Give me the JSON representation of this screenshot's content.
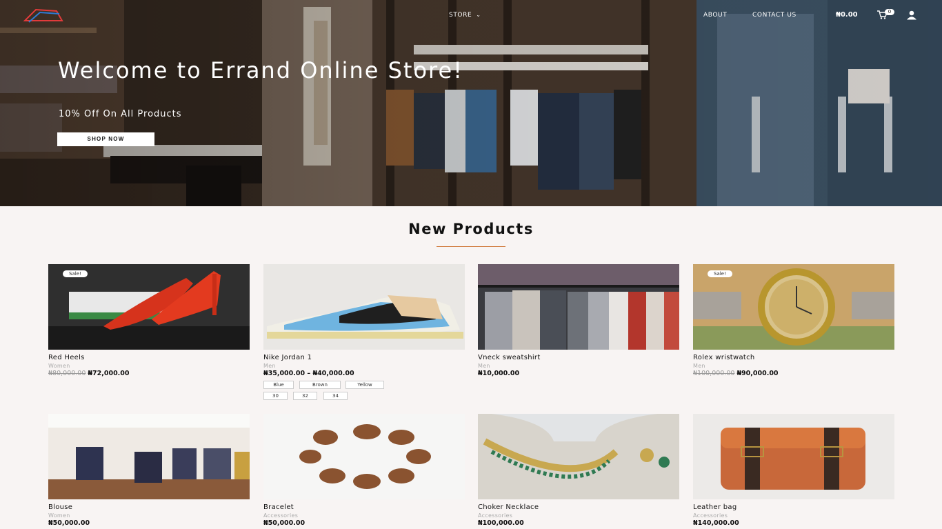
{
  "header": {
    "nav": {
      "store": "STORE",
      "about": "ABOUT",
      "contact": "CONTACT US"
    },
    "cart_total": "₦0.00",
    "cart_count": "0"
  },
  "hero": {
    "title": "Welcome to Errand Online Store!",
    "subtitle": "10% Off On All Products",
    "button": "SHOP NOW"
  },
  "section": {
    "title": "New Products"
  },
  "products": [
    {
      "name": "Red Heels",
      "category": "Women",
      "old_price": "₦80,000.00",
      "price": "₦72,000.00",
      "badge": "Sale!"
    },
    {
      "name": "Nike Jordan 1",
      "category": "Men",
      "price": "₦35,000.00 – ₦40,000.00",
      "colors": [
        "Blue",
        "Brown",
        "Yellow"
      ],
      "sizes": [
        "30",
        "32",
        "34"
      ]
    },
    {
      "name": "Vneck sweatshirt",
      "category": "Men",
      "price": "₦10,000.00"
    },
    {
      "name": "Rolex wristwatch",
      "category": "Men",
      "old_price": "₦100,000.00",
      "price": "₦90,000.00",
      "badge": "Sale!"
    },
    {
      "name": "Blouse",
      "category": "Women",
      "price": "₦50,000.00"
    },
    {
      "name": "Bracelet",
      "category": "Accessories",
      "price": "₦50,000.00"
    },
    {
      "name": "Choker Necklace",
      "category": "Accessories",
      "price": "₦100,000.00"
    },
    {
      "name": "Leather bag",
      "category": "Accessories",
      "price": "₦140,000.00"
    }
  ]
}
